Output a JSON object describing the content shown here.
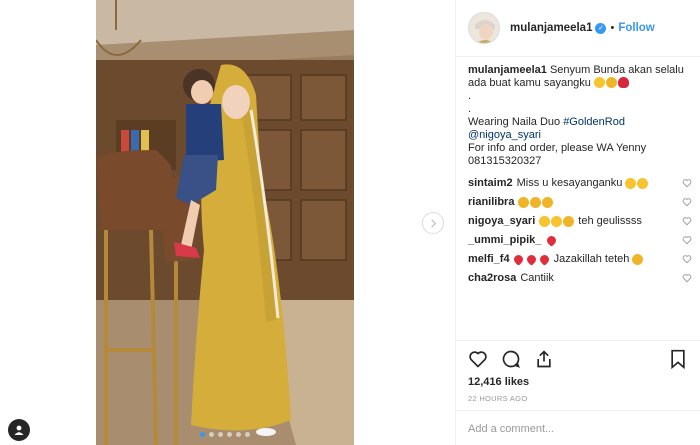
{
  "post": {
    "username": "mulanjameela1",
    "verified": true,
    "separator": "•",
    "follow_label": "Follow",
    "carousel": {
      "dot_count": 6,
      "active_index": 0
    }
  },
  "caption": {
    "username": "mulanjameela1",
    "text_1": "Senyum Bunda akan selalu ada buat kamu sayangku",
    "dot_1": ".",
    "dot_2": ".",
    "wearing": "Wearing Naila Duo",
    "hashtag": "#GoldenRod",
    "mention": "@nigoya_syari",
    "info": "For info and order, please WA Yenny",
    "phone": "081315320327"
  },
  "comments": [
    {
      "username": "sintaim2",
      "text": "Miss u kesayanganku"
    },
    {
      "username": "rianilibra",
      "text": ""
    },
    {
      "username": "nigoya_syari",
      "text": "teh geulissss"
    },
    {
      "username": "_ummi_pipik_",
      "text": ""
    },
    {
      "username": "melfi_f4",
      "text": "Jazakillah teteh"
    },
    {
      "username": "cha2rosa",
      "text": "Cantiik"
    }
  ],
  "stats": {
    "likes": "12,416 likes",
    "time": "22 HOURS AGO"
  },
  "composer": {
    "placeholder": "Add a comment..."
  },
  "icons": {
    "like": "heart-icon",
    "comment": "comment-icon",
    "share": "share-icon",
    "save": "bookmark-icon",
    "next": "chevron-right-icon"
  },
  "colors": {
    "link": "#3897f0",
    "mention": "#003569",
    "border": "#efefef"
  }
}
